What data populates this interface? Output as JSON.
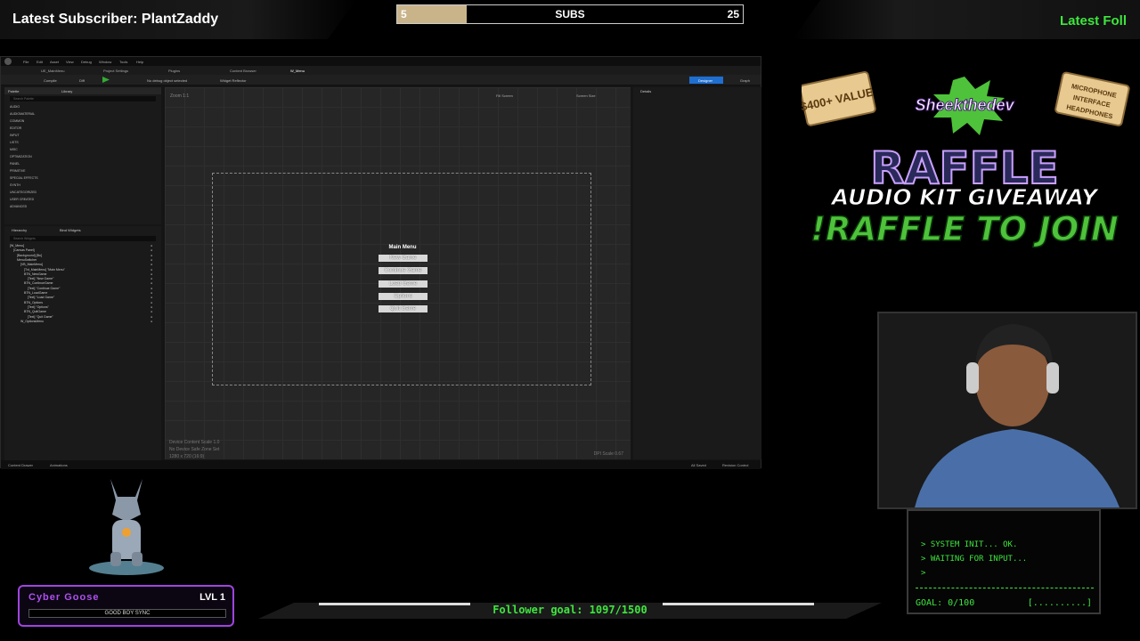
{
  "overlay": {
    "latest_subscriber": "Latest Subscriber: PlantZaddy",
    "latest_follower": "Latest Foll",
    "subs": {
      "label": "SUBS",
      "current": "5",
      "goal": "25",
      "progress": 0.2
    },
    "follower_goal": "Follower goal: 1097/1500"
  },
  "editor": {
    "menu": [
      "File",
      "Edit",
      "Asset",
      "View",
      "Debug",
      "Window",
      "Tools",
      "Help"
    ],
    "project": "UE_MainMenu",
    "tabs": [
      "Project Settings",
      "Plugins",
      "Content Browser",
      "W_Menu"
    ],
    "toolbar": {
      "compile": "Compile",
      "diff": "Diff",
      "debug": "No debug object selected",
      "reflector": "Widget Reflector",
      "designer": "Designer",
      "graph": "Graph"
    },
    "palette": {
      "title": "Palette",
      "library": "Library",
      "search_placeholder": "Search Palette",
      "categories": [
        "AUDIO",
        "AUDIOMATERIAL",
        "COMMON",
        "EDITOR",
        "INPUT",
        "LISTS",
        "MISC",
        "OPTIMIZATION",
        "PANEL",
        "PRIMITIVE",
        "SPECIAL EFFECTS",
        "SYNTH",
        "UNCATEGORIZED",
        "USER CREATED",
        "ADVANCED"
      ]
    },
    "hierarchy": {
      "tabs": [
        "Hierarchy",
        "Bind Widgets"
      ],
      "search_placeholder": "Search Widgets",
      "items": [
        "[W_Menu]",
        "[Canvas Panel]",
        "[Background] [Bo]",
        "MenuSwitcher",
        "[VB_MainMenu]",
        "[Txt_MainMenu] \"Main Menu\"",
        "BTN_NewGame",
        "[Text] \"New Game\"",
        "BTN_ContinueGame",
        "[Text] \"Continue Game\"",
        "BTN_LoadGame",
        "[Text] \"Load Game\"",
        "BTN_Options",
        "[Text] \"Options\"",
        "BTN_QuitGame",
        "[Text] \"Quit Game\"",
        "W_OptionsMenu"
      ]
    },
    "canvas": {
      "zoom": "Zoom 1:1",
      "menu_title": "Main Menu",
      "buttons": [
        "New Game",
        "Continue Game",
        "Load Game",
        "Options",
        "Quit Game"
      ],
      "footer": [
        "Device Content Scale 1.0",
        "No Device Safe Zone Set",
        "1280 x 720 (16:9)"
      ],
      "dpi": "DPI Scale 0.67",
      "fill_screen": "Fill Screen",
      "screen_size": "Screen Size"
    },
    "details": {
      "title": "Details"
    },
    "status": {
      "content_drawer": "Content Drawer",
      "animations": "Animations",
      "all_saved": "All Saved",
      "revision": "Revision Control"
    }
  },
  "raffle": {
    "value_ticket": "$400+ VALUE",
    "brand": "Sheekthedev",
    "title": "RAFFLE",
    "subtitle": "AUDIO KIT GIVEAWAY",
    "cta": "!RAFFLE TO JOIN",
    "right_ticket": [
      "MICROPHONE",
      "INTERFACE",
      "HEADPHONES"
    ]
  },
  "terminal": {
    "lines": [
      "> SYSTEM INIT... OK.",
      "> WAITING FOR INPUT...",
      ">"
    ],
    "goal": "GOAL: 0/100",
    "progress": "[..........]"
  },
  "pet": {
    "name": "Cyber Goose",
    "level": "LVL 1",
    "tagline": "GOOD BOY SYNC"
  },
  "colors": {
    "accent_green": "#3ee63e",
    "ue_blue": "#1f6fd0",
    "pet_purple": "#a044e0",
    "subs_fill": "#c9b48a"
  }
}
